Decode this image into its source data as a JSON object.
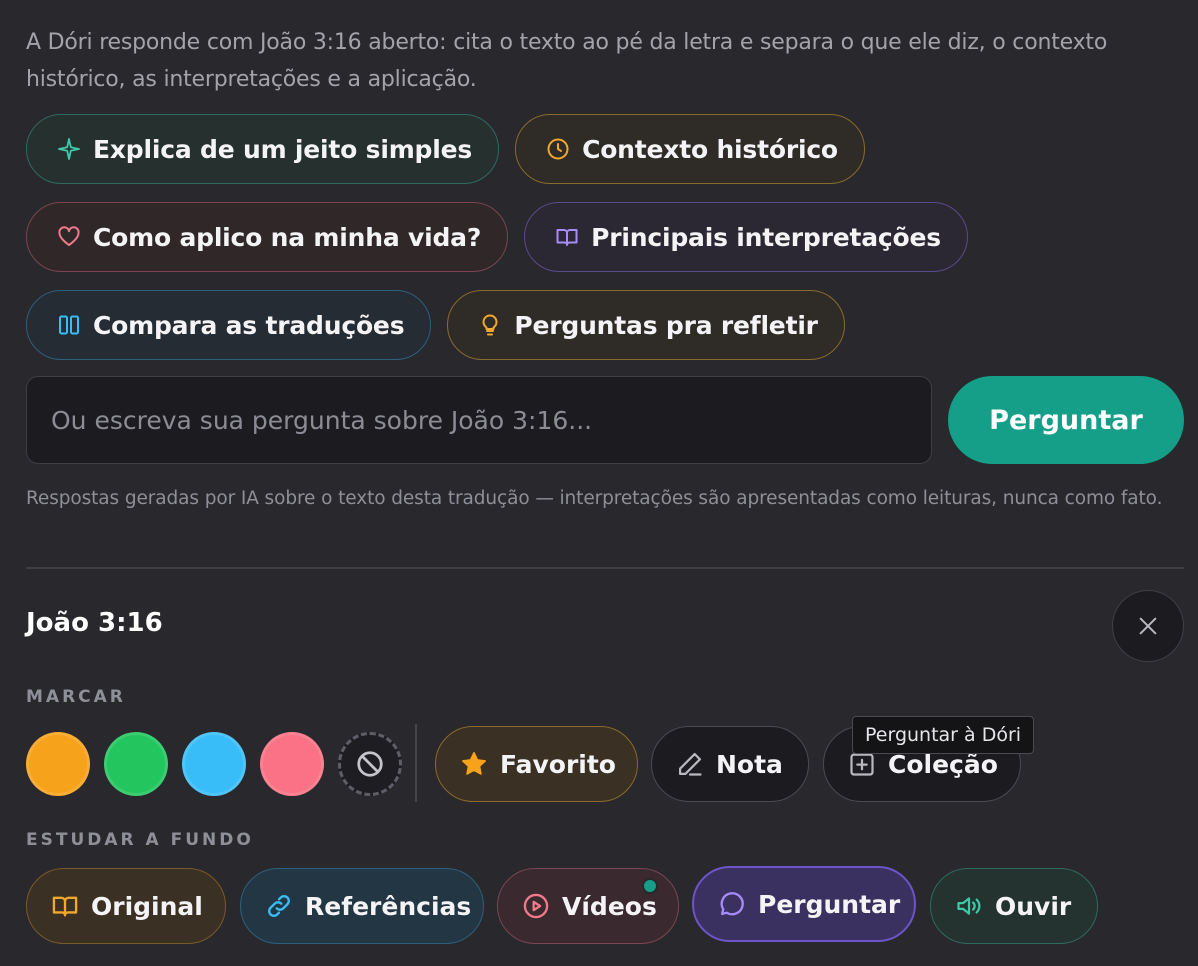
{
  "intro": "A Dóri responde com João 3:16 aberto: cita o texto ao pé da letra e separa o que ele diz, o contexto histórico, as interpretações e a aplicação.",
  "chips": [
    {
      "label": "Explica de um jeito simples",
      "icon": "sparkle-icon",
      "color": "#3ec9a7"
    },
    {
      "label": "Contexto histórico",
      "icon": "clock-icon",
      "color": "#f0a92e"
    },
    {
      "label": "Como aplico na minha vida?",
      "icon": "heart-icon",
      "color": "#f07a8c"
    },
    {
      "label": "Principais interpretações",
      "icon": "book-icon",
      "color": "#a78bfa"
    },
    {
      "label": "Compara as traduções",
      "icon": "columns-icon",
      "color": "#38bdf8"
    },
    {
      "label": "Perguntas pra refletir",
      "icon": "lightbulb-icon",
      "color": "#f0a92e"
    }
  ],
  "ask": {
    "placeholder": "Ou escreva sua pergunta sobre João 3:16...",
    "button": "Perguntar"
  },
  "disclaimer": "Respostas geradas por IA sobre o texto desta tradução — interpretações são apresentadas como leituras, nunca como fato.",
  "verse": {
    "title": "João 3:16"
  },
  "marcar": {
    "label": "MARCAR",
    "colors": [
      "#f7a21b",
      "#22c55e",
      "#38bdf8",
      "#fb7185"
    ]
  },
  "actions": {
    "favorito": "Favorito",
    "nota": "Nota",
    "colecao": "Coleção"
  },
  "tooltip": "Perguntar à Dóri",
  "estudar": {
    "label": "ESTUDAR A FUNDO",
    "original": "Original",
    "referencias": "Referências",
    "videos": "Vídeos",
    "perguntar": "Perguntar",
    "ouvir": "Ouvir"
  }
}
